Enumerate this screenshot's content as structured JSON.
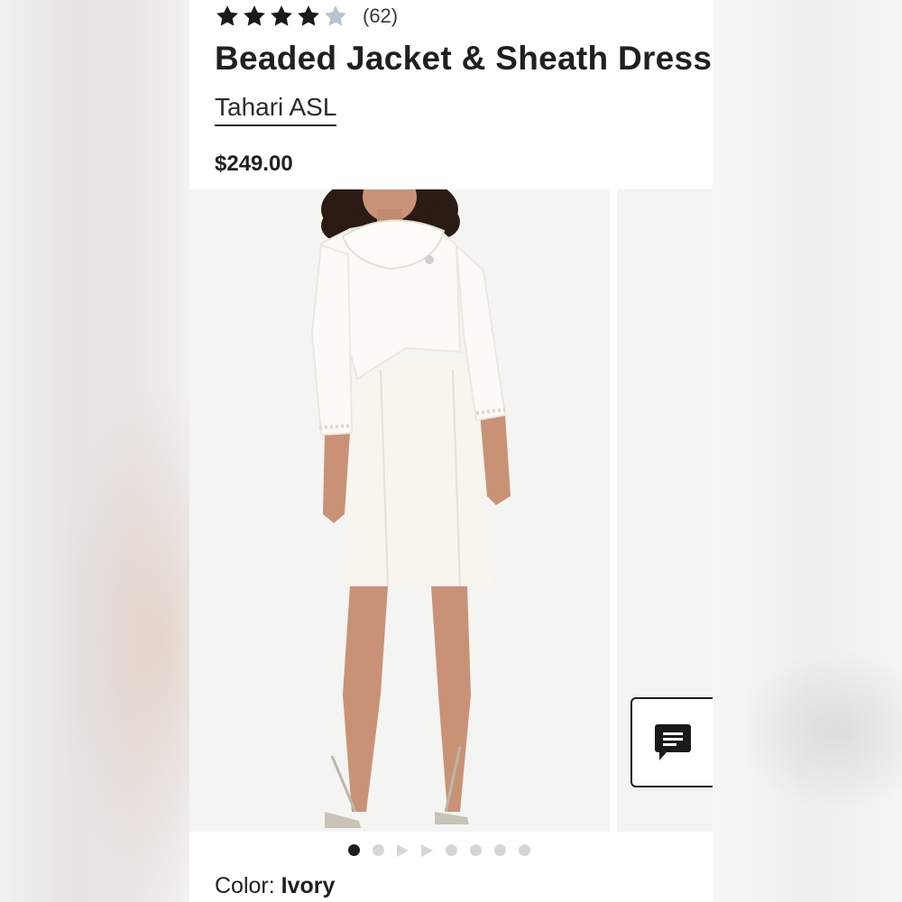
{
  "product": {
    "rating": {
      "stars": 4.5,
      "max": 5,
      "count_label": "(62)"
    },
    "title": "Beaded Jacket & Sheath Dress",
    "brand": "Tahari ASL",
    "price": "$249.00"
  },
  "gallery": {
    "main_image": "model-in-ivory-beaded-jacket-and-sheath-dress",
    "active_index": 0,
    "indicators": [
      "dot",
      "dot",
      "video-play",
      "video-play",
      "dot",
      "dot",
      "dot",
      "dot"
    ]
  },
  "chat": {
    "icon": "chat-bubble-icon"
  },
  "color": {
    "label": "Color:",
    "value": "Ivory"
  },
  "colors": {
    "star_filled": "#1a1a1a",
    "star_empty": "#b8c3cb",
    "dress": "#f7f5ee",
    "skin": "#c99276",
    "hair": "#2a1c14"
  }
}
